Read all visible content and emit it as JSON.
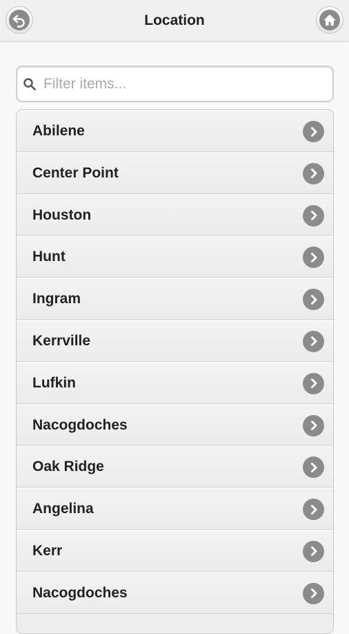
{
  "header": {
    "title": "Location",
    "back_icon": "back-arrow-icon",
    "home_icon": "home-icon"
  },
  "search": {
    "placeholder": "Filter items...",
    "value": "",
    "icon": "search-icon"
  },
  "list": {
    "items": [
      {
        "label": "Abilene"
      },
      {
        "label": "Center Point"
      },
      {
        "label": "Houston"
      },
      {
        "label": "Hunt"
      },
      {
        "label": "Ingram"
      },
      {
        "label": "Kerrville"
      },
      {
        "label": "Lufkin"
      },
      {
        "label": "Nacogdoches"
      },
      {
        "label": "Oak Ridge"
      },
      {
        "label": "Angelina"
      },
      {
        "label": "Kerr"
      },
      {
        "label": "Nacogdoches"
      }
    ],
    "item_icon": "chevron-right-icon"
  },
  "colors": {
    "header_bg": "#f0f0f0",
    "list_bg": "#ededed",
    "icon_gray": "#8b8b8b",
    "text": "#222222"
  }
}
